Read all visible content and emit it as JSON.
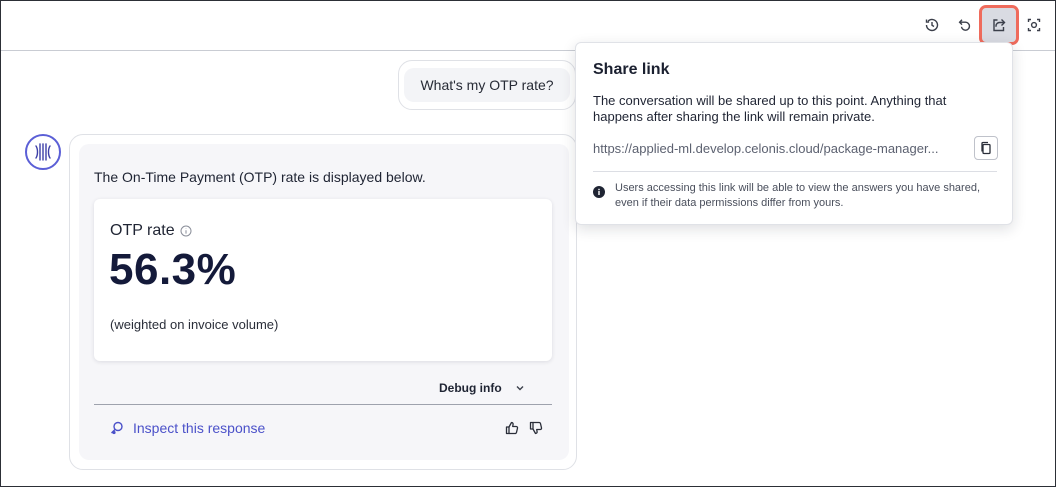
{
  "toolbar": {
    "history_icon": "history-icon",
    "undo_icon": "undo-icon",
    "share_icon": "share-icon",
    "scan_icon": "scan-icon"
  },
  "conversation": {
    "user_message": "What's my OTP rate?",
    "answer": {
      "intro": "The On-Time Payment (OTP) rate is displayed below.",
      "kpi": {
        "label": "OTP rate",
        "value": "56.3%",
        "note": "(weighted on invoice volume)"
      },
      "debug_label": "Debug info",
      "inspect_label": "Inspect this response"
    }
  },
  "share_popover": {
    "title": "Share link",
    "description": "The conversation will be shared up to this point. Anything that happens after sharing the link will remain private.",
    "link": "https://applied-ml.develop.celonis.cloud/package-manager...",
    "note": "Users accessing this link will be able to view the answers you have shared, even if their data permissions differ from yours."
  },
  "colors": {
    "accent": "#4b51c9",
    "highlight": "#ef6b5c",
    "kpi_value": "#141a3a"
  }
}
